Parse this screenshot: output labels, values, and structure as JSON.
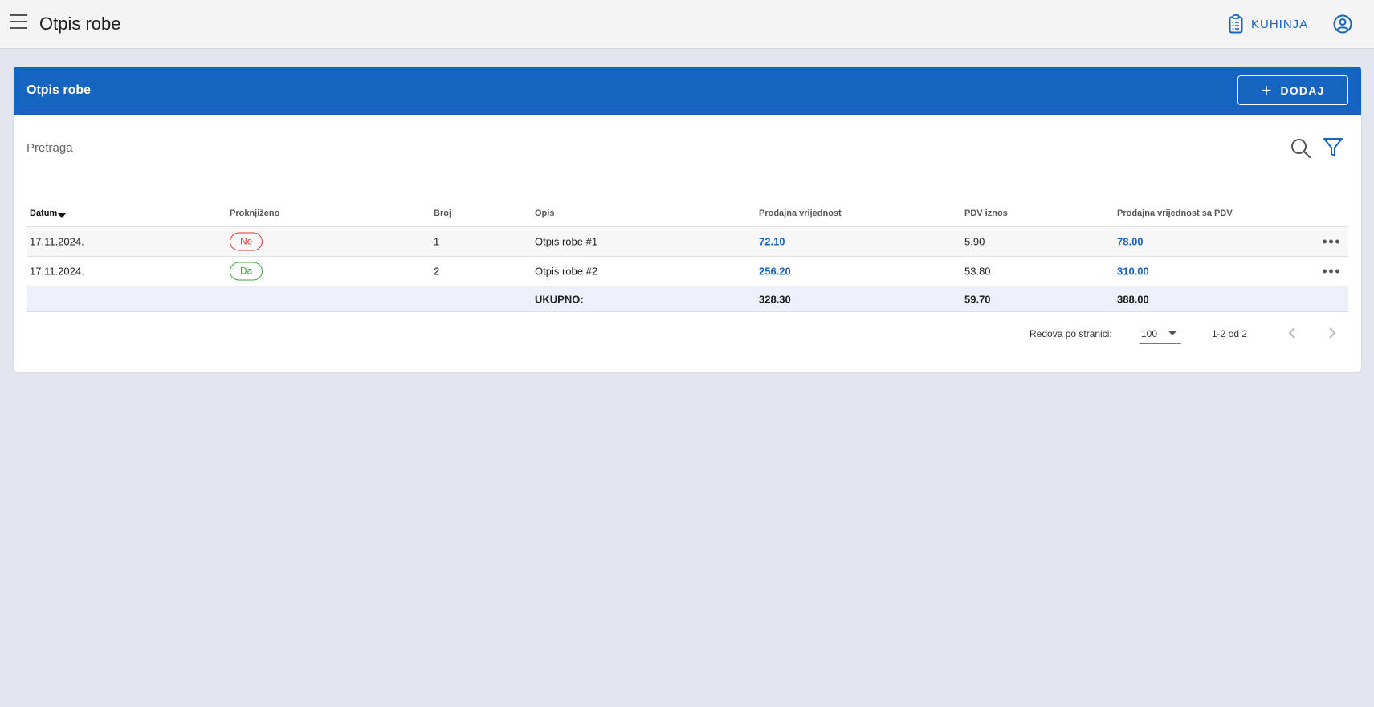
{
  "appbar": {
    "title": "Otpis robe",
    "location_label": "KUHINJA",
    "icons": [
      "menu-icon",
      "clipboard-icon",
      "account-circle-icon"
    ]
  },
  "card": {
    "title": "Otpis robe",
    "add_label": "DODAJ"
  },
  "search": {
    "placeholder": "Pretraga"
  },
  "table": {
    "headers": {
      "datum": "Datum",
      "proknjizeno": "Proknjiženo",
      "broj": "Broj",
      "opis": "Opis",
      "prodajna": "Prodajna vrijednost",
      "pdv": "PDV iznos",
      "prodajna_pdv": "Prodajna vrijednost sa PDV"
    },
    "rows": [
      {
        "datum": "17.11.2024.",
        "proknjizeno": "Ne",
        "broj": "1",
        "opis": "Otpis robe #1",
        "prodajna": "72.10",
        "pdv": "5.90",
        "prodajna_pdv": "78.00"
      },
      {
        "datum": "17.11.2024.",
        "proknjizeno": "Da",
        "broj": "2",
        "opis": "Otpis robe #2",
        "prodajna": "256.20",
        "pdv": "53.80",
        "prodajna_pdv": "310.00"
      }
    ],
    "total": {
      "label": "UKUPNO:",
      "prodajna": "328.30",
      "pdv": "59.70",
      "prodajna_pdv": "388.00"
    }
  },
  "pagination": {
    "rows_label": "Redova po stranici:",
    "rows_per_page": "100",
    "range": "1-2 od 2"
  },
  "colors": {
    "primary": "#1565c0",
    "chip_no": "#e53935",
    "chip_yes": "#43a047",
    "background": "#e3e6ef"
  }
}
